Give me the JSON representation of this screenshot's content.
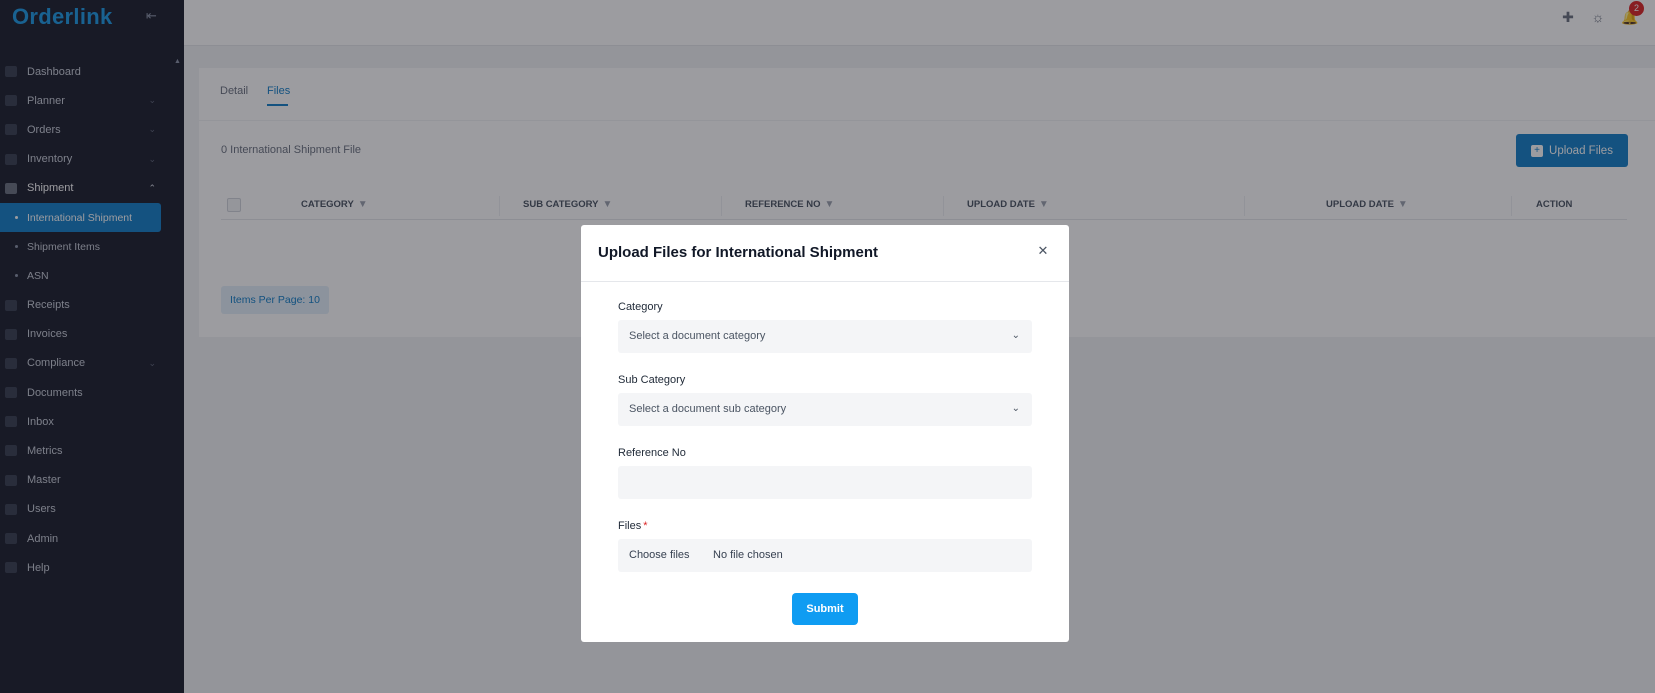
{
  "app": {
    "logo_text": "Orderlink"
  },
  "sidebar": {
    "items": [
      {
        "label": "Dashboard",
        "icon": "dashboard-icon",
        "has_chevron": false
      },
      {
        "label": "Planner",
        "icon": "planner-icon",
        "has_chevron": true
      },
      {
        "label": "Orders",
        "icon": "cart-icon",
        "has_chevron": true
      },
      {
        "label": "Inventory",
        "icon": "chart-icon",
        "has_chevron": true
      },
      {
        "label": "Shipment",
        "icon": "truck-icon",
        "has_chevron": true,
        "expanded": true
      },
      {
        "label": "Receipts",
        "icon": "receipt-icon",
        "has_chevron": false
      },
      {
        "label": "Invoices",
        "icon": "invoice-icon",
        "has_chevron": false
      },
      {
        "label": "Compliance",
        "icon": "compliance-icon",
        "has_chevron": true
      },
      {
        "label": "Documents",
        "icon": "documents-icon",
        "has_chevron": false
      },
      {
        "label": "Inbox",
        "icon": "inbox-icon",
        "has_chevron": false
      },
      {
        "label": "Metrics",
        "icon": "metrics-icon",
        "has_chevron": false
      },
      {
        "label": "Master",
        "icon": "master-icon",
        "has_chevron": false
      },
      {
        "label": "Users",
        "icon": "users-icon",
        "has_chevron": false
      },
      {
        "label": "Admin",
        "icon": "admin-icon",
        "has_chevron": false
      },
      {
        "label": "Help",
        "icon": "help-icon",
        "has_chevron": false
      }
    ],
    "shipment_sub_items": [
      {
        "label": "International Shipment",
        "active": true
      },
      {
        "label": "Shipment Items",
        "active": false
      },
      {
        "label": "ASN",
        "active": false
      }
    ]
  },
  "topbar": {
    "icons": [
      "plus-icon",
      "sun-icon",
      "bell-icon"
    ],
    "notification_count": "2"
  },
  "main": {
    "tabs": [
      {
        "label": "Detail",
        "active": false
      },
      {
        "label": "Files",
        "active": true
      }
    ],
    "file_count_text": "0 International Shipment File",
    "upload_button_label": "Upload Files",
    "table": {
      "columns": [
        "CATEGORY",
        "SUB CATEGORY",
        "REFERENCE NO",
        "UPLOAD DATE",
        "UPLOAD DATE",
        "ACTION"
      ]
    },
    "items_per_page_label": "Items Per Page: 10"
  },
  "modal": {
    "title": "Upload Files for International Shipment",
    "category": {
      "label": "Category",
      "placeholder": "Select a document category"
    },
    "sub_category": {
      "label": "Sub Category",
      "placeholder": "Select a document sub category"
    },
    "reference_no": {
      "label": "Reference No",
      "value": ""
    },
    "files": {
      "label": "Files",
      "required_mark": "*",
      "button_label": "Choose files",
      "status": "No file chosen"
    },
    "submit_label": "Submit"
  },
  "colors": {
    "sidebar_bg": "#1c1f2e",
    "brand_blue": "#1580c8",
    "submit_blue": "#0f9cf2",
    "badge_red": "#dc2626"
  }
}
